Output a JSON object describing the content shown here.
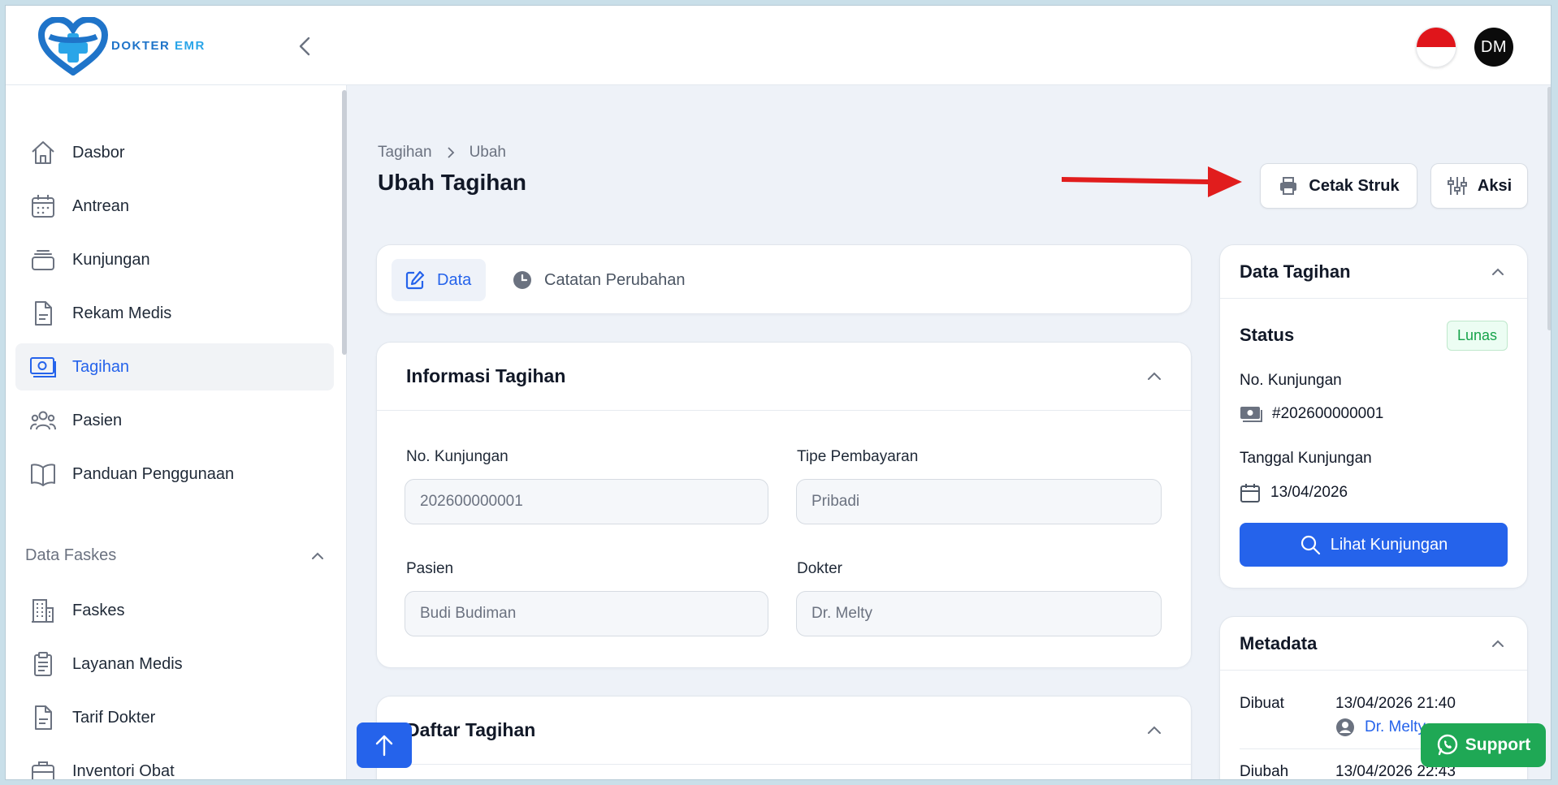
{
  "header": {
    "brand_part1": "DOKTER",
    "brand_part2": "EMR",
    "avatar_initials": "DM",
    "flag": "Indonesia",
    "accent": "#2563eb"
  },
  "sidebar": {
    "items": [
      {
        "label": "Dasbor",
        "icon": "home-icon"
      },
      {
        "label": "Antrean",
        "icon": "calendar-icon"
      },
      {
        "label": "Kunjungan",
        "icon": "stack-icon"
      },
      {
        "label": "Rekam Medis",
        "icon": "document-icon"
      },
      {
        "label": "Tagihan",
        "icon": "banknote-icon"
      },
      {
        "label": "Pasien",
        "icon": "users-icon"
      },
      {
        "label": "Panduan Penggunaan",
        "icon": "book-icon"
      }
    ],
    "section_title": "Data Faskes",
    "section_items": [
      {
        "label": "Faskes",
        "icon": "building-icon"
      },
      {
        "label": "Layanan Medis",
        "icon": "clipboard-icon"
      },
      {
        "label": "Tarif Dokter",
        "icon": "document-icon"
      },
      {
        "label": "Inventori Obat",
        "icon": "briefcase-icon"
      }
    ]
  },
  "breadcrumb": {
    "parent": "Tagihan",
    "current": "Ubah"
  },
  "page_title": "Ubah Tagihan",
  "actions": {
    "print_label": "Cetak Struk",
    "more_label": "Aksi"
  },
  "tabs": [
    {
      "label": "Data"
    },
    {
      "label": "Catatan Perubahan"
    }
  ],
  "info_card": {
    "title": "Informasi Tagihan",
    "fields": {
      "no_kunjungan_label": "No. Kunjungan",
      "no_kunjungan_value": "202600000001",
      "tipe_label": "Tipe Pembayaran",
      "tipe_value": "Pribadi",
      "pasien_label": "Pasien",
      "pasien_value": "Budi Budiman",
      "dokter_label": "Dokter",
      "dokter_value": "Dr. Melty"
    }
  },
  "daftar_card": {
    "title": "Daftar Tagihan"
  },
  "data_tagihan": {
    "title": "Data Tagihan",
    "status_label": "Status",
    "status_value": "Lunas",
    "no_kunjungan_label": "No. Kunjungan",
    "no_kunjungan_value": "#202600000001",
    "tanggal_label": "Tanggal Kunjungan",
    "tanggal_value": "13/04/2026",
    "button_label": "Lihat Kunjungan"
  },
  "metadata": {
    "title": "Metadata",
    "created_label": "Dibuat",
    "created_value": "13/04/2026 21:40",
    "created_by": "Dr. Melty",
    "updated_label": "Diubah",
    "updated_value": "13/04/2026 22:43"
  },
  "support_label": "Support"
}
